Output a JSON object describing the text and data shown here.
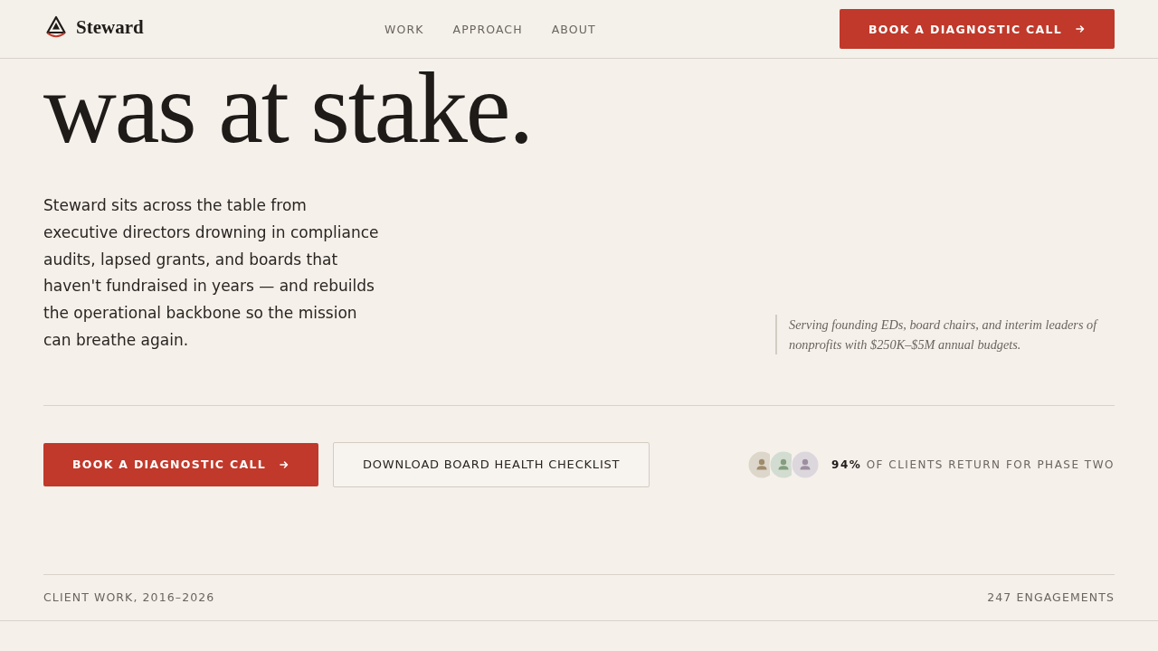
{
  "header": {
    "brand": "Steward",
    "nav": [
      {
        "label": "WORK"
      },
      {
        "label": "APPROACH"
      },
      {
        "label": "ABOUT"
      }
    ],
    "cta": {
      "label": "BOOK A DIAGNOSTIC CALL"
    }
  },
  "hero": {
    "headline": "was at stake.",
    "intro": "Steward sits across the table from executive directors drowning in compliance audits, lapsed grants, and boards that haven't fundraised in years — and rebuilds the operational backbone so the mission can breathe again.",
    "audience_note": "Serving founding EDs, board chairs, and interim leaders of nonprofits with $250K–$5M annual budgets."
  },
  "actions": {
    "primary": {
      "label": "BOOK A DIAGNOSTIC CALL"
    },
    "secondary": {
      "label": "DOWNLOAD BOARD HEALTH CHECKLIST"
    },
    "proof": {
      "avatars": [
        {
          "color": "#ddd6cb"
        },
        {
          "color": "#d3dcd1"
        },
        {
          "color": "#dcd7dd"
        }
      ],
      "text": "**94%** OF CLIENTS RETURN FOR PHASE TWO"
    }
  },
  "work_bar": {
    "title": "CLIENT WORK, 2016–2026",
    "count": "247 ENGAGEMENTS"
  }
}
